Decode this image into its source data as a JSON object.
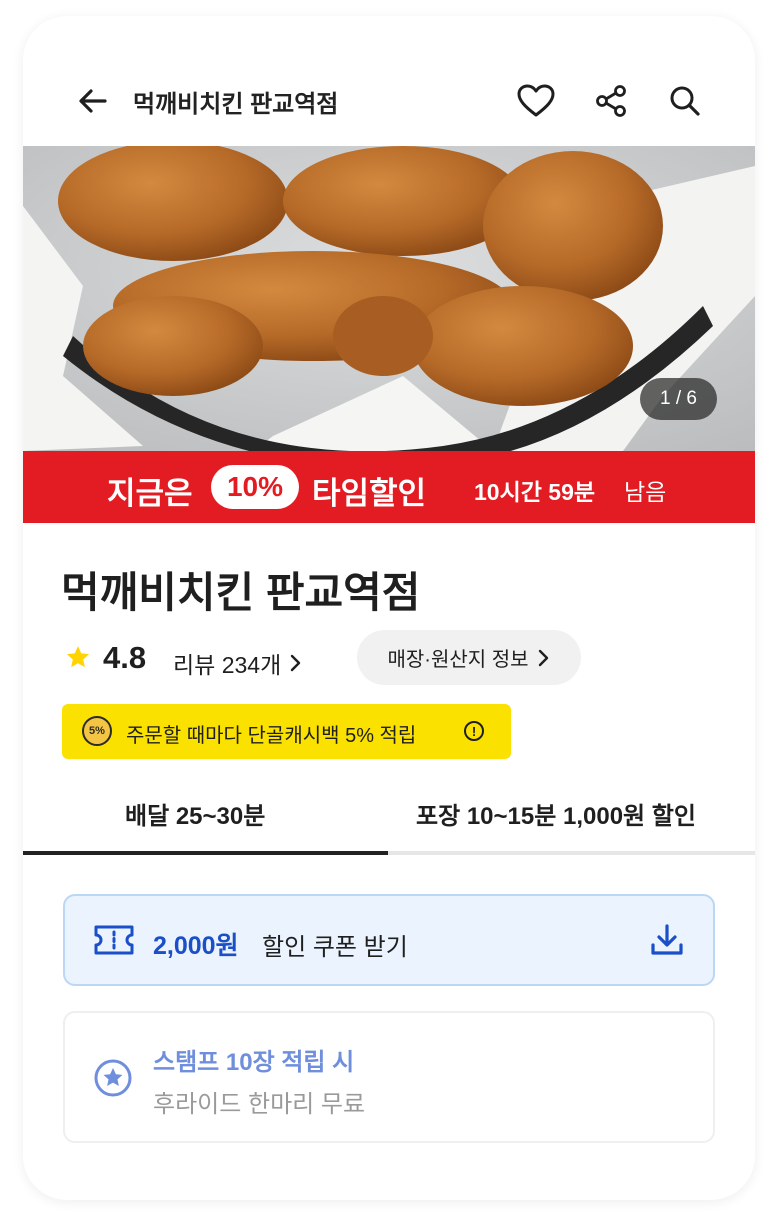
{
  "header": {
    "title": "먹깨비치킨 판교역점",
    "icons": [
      "back-arrow-icon",
      "heart-icon",
      "share-icon",
      "search-icon"
    ]
  },
  "hero": {
    "image_counter": "1 / 6"
  },
  "promo": {
    "text_before": "지금은",
    "discount": "10%",
    "text_after": "타임할인",
    "time_left": "10시간 59분",
    "time_suffix": "남음",
    "color": "#e21c22"
  },
  "store": {
    "name": "먹깨비치킨 판교역점",
    "rating": "4.8",
    "reviews_label": "리뷰 234개",
    "info_button": "매장·원산지 정보"
  },
  "cashback": {
    "badge": "5%",
    "text": "주문할 때마다 단골캐시백 5% 적립"
  },
  "tabs": [
    {
      "label": "배달 25~30분",
      "active": true
    },
    {
      "label": "포장 10~15분 1,000원 할인",
      "active": false
    }
  ],
  "coupon": {
    "amount": "2,000원",
    "label": "할인 쿠폰 받기",
    "accent": "#1a4fc7"
  },
  "stamp": {
    "title": "스탬프 10장 적립 시",
    "reward": "후라이드 한마리 무료"
  }
}
